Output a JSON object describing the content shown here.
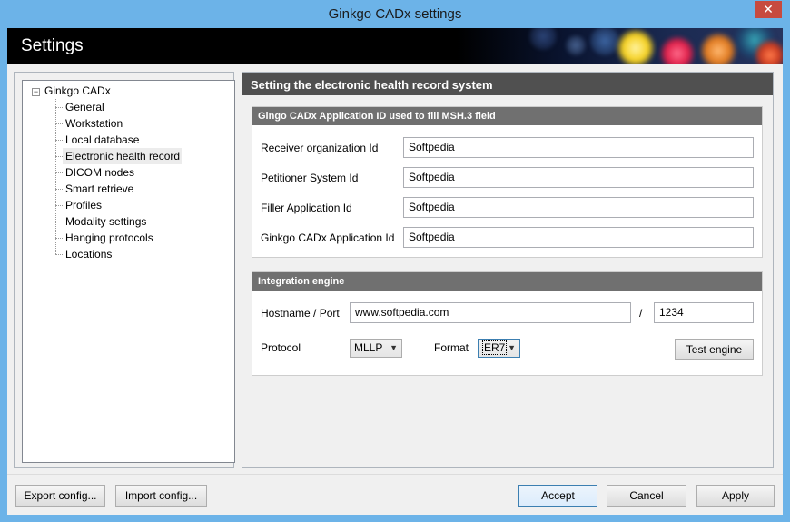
{
  "window": {
    "title": "Ginkgo CADx settings",
    "close_glyph": "✕"
  },
  "banner": {
    "heading": "Settings"
  },
  "tree": {
    "root_label": "Ginkgo CADx",
    "expander_glyph": "−",
    "items": [
      {
        "label": "General"
      },
      {
        "label": "Workstation"
      },
      {
        "label": "Local database"
      },
      {
        "label": "Electronic health record",
        "selected": true
      },
      {
        "label": "DICOM nodes"
      },
      {
        "label": "Smart retrieve"
      },
      {
        "label": "Profiles"
      },
      {
        "label": "Modality settings"
      },
      {
        "label": "Hanging protocols"
      },
      {
        "label": "Locations"
      }
    ]
  },
  "content": {
    "header": "Setting the electronic health record system",
    "app_group": {
      "title": "Gingo CADx Application ID used to fill MSH.3 field",
      "fields": [
        {
          "label": "Receiver organization Id",
          "value": "Softpedia"
        },
        {
          "label": "Petitioner System Id",
          "value": "Softpedia"
        },
        {
          "label": "Filler Application Id",
          "value": "Softpedia"
        },
        {
          "label": "Ginkgo CADx Application Id",
          "value": "Softpedia"
        }
      ]
    },
    "integration": {
      "title": "Integration engine",
      "hostname_label": "Hostname / Port",
      "hostname_value": "www.softpedia.com",
      "separator": "/",
      "port_value": "1234",
      "protocol_label": "Protocol",
      "protocol_value": "MLLP",
      "format_label": "Format",
      "format_value": "ER7",
      "test_button": "Test engine"
    }
  },
  "footer": {
    "export_button": "Export config...",
    "import_button": "Import config...",
    "accept_button": "Accept",
    "cancel_button": "Cancel",
    "apply_button": "Apply"
  },
  "colors": {
    "title_bar": "#6cb3e8",
    "close_button": "#c74a3f",
    "panel_header": "#505050",
    "group_header": "#707070",
    "default_button_border": "#3c7fb1"
  }
}
